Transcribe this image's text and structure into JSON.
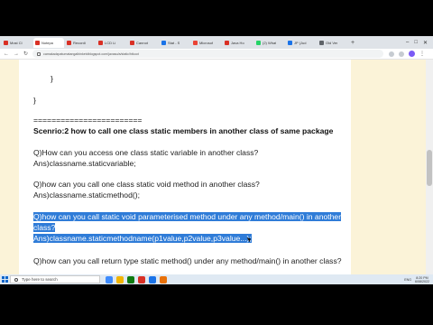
{
  "browser": {
    "tabs": [
      {
        "label": "Most Cl",
        "color": "#d93025"
      },
      {
        "label": "Notepa",
        "color": "#d93025",
        "active": true
      },
      {
        "label": "Recordi",
        "color": "#d93025"
      },
      {
        "label": "LCD Li",
        "color": "#d93025"
      },
      {
        "label": "Cannot",
        "color": "#d93025"
      },
      {
        "label": "Stat - S",
        "color": "#1a73e8"
      },
      {
        "label": "Microsof",
        "color": "#ea4335"
      },
      {
        "label": "Java Ho",
        "color": "#d93025"
      },
      {
        "label": "(2) What",
        "color": "#25d366"
      },
      {
        "label": "JP (Jud",
        "color": "#1a73e8"
      },
      {
        "label": "Old Ver",
        "color": "#5f6368"
      }
    ],
    "url": "camakadzpatumatangalbinketdblogspot.com/javaso/a/static/htkoot"
  },
  "content": {
    "brace1": "}",
    "brace2": "}",
    "divider": "========================",
    "heading": "Scenrio:2 how to call one class static members in another class of same package",
    "q1": "Q)How can you access one class static variable in another class?",
    "a1": "Ans)classname.staticvariable;",
    "q2": "Q)how can you call one class static void method in another class?",
    "a2": "Ans)classname.staticmethod();",
    "q3_line1": "Q)how can you call static void parameterised method under any method/main() in another",
    "q3_line2": "class?",
    "a3": "Ans)classname.staticmethodname(p1value,p2value,p3value...);",
    "q4": "Q)how can you call return type static method() under any method/main() in another class?"
  },
  "taskbar": {
    "search_placeholder": "Type here to search",
    "apps": [
      "#3d8bfd",
      "#f2b400",
      "#0f7b0f",
      "#d93025",
      "#1a73e8",
      "#e8710a"
    ],
    "tray_text": "ENG",
    "time": "8:20 PM",
    "date": "6/08/2022"
  }
}
